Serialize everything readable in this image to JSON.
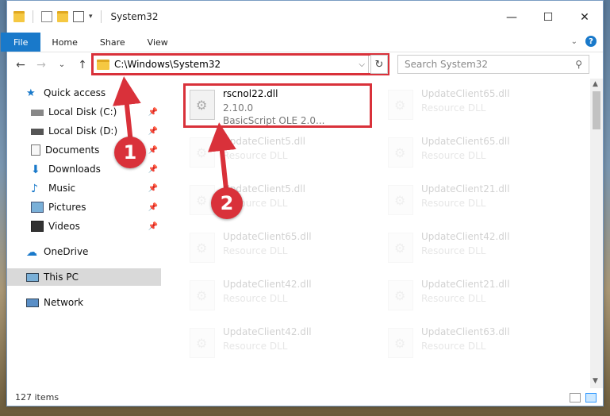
{
  "title": "System32",
  "window_controls": {
    "minimize": "—",
    "maximize": "☐",
    "close": "✕"
  },
  "ribbon": {
    "tabs": [
      "File",
      "Home",
      "Share",
      "View"
    ]
  },
  "nav": {
    "back": "←",
    "forward": "→",
    "recent": "⌄",
    "up": "↑"
  },
  "address": {
    "path": "C:\\Windows\\System32"
  },
  "search": {
    "placeholder": "Search System32"
  },
  "sidebar": {
    "items": [
      {
        "label": "Quick access",
        "icon": "star-icon",
        "pinned": false
      },
      {
        "label": "Local Disk (C:)",
        "icon": "drive-icon",
        "pinned": true
      },
      {
        "label": "Local Disk (D:)",
        "icon": "drive-icon",
        "pinned": true
      },
      {
        "label": "Documents",
        "icon": "documents-icon",
        "pinned": true
      },
      {
        "label": "Downloads",
        "icon": "download-icon",
        "pinned": true
      },
      {
        "label": "Music",
        "icon": "music-icon",
        "pinned": true
      },
      {
        "label": "Pictures",
        "icon": "pictures-icon",
        "pinned": true
      },
      {
        "label": "Videos",
        "icon": "videos-icon",
        "pinned": true
      },
      {
        "label": "OneDrive",
        "icon": "cloud-icon",
        "pinned": false
      },
      {
        "label": "This PC",
        "icon": "computer-icon",
        "pinned": false
      },
      {
        "label": "Network",
        "icon": "network-icon",
        "pinned": false
      }
    ]
  },
  "files": [
    {
      "name": "rscnol22.dll",
      "line2": "2.10.0",
      "line3": "BasicScript OLE 2.0...",
      "highlight": true
    },
    {
      "name": "UpdateClient65.dll",
      "line2": "Resource DLL"
    },
    {
      "name": "UpdateClient5.dll",
      "line2": "Resource DLL"
    },
    {
      "name": "UpdateClient65.dll",
      "line2": "Resource DLL"
    },
    {
      "name": "UpdateClient5.dll",
      "line2": "Resource DLL"
    },
    {
      "name": "UpdateClient21.dll",
      "line2": "Resource DLL"
    },
    {
      "name": "UpdateClient65.dll",
      "line2": "Resource DLL"
    },
    {
      "name": "UpdateClient42.dll",
      "line2": "Resource DLL"
    },
    {
      "name": "UpdateClient42.dll",
      "line2": "Resource DLL"
    },
    {
      "name": "UpdateClient21.dll",
      "line2": "Resource DLL"
    },
    {
      "name": "UpdateClient42.dll",
      "line2": "Resource DLL"
    },
    {
      "name": "UpdateClient63.dll",
      "line2": "Resource DLL"
    }
  ],
  "status": {
    "count": "127 items"
  },
  "markers": [
    "1",
    "2"
  ],
  "colors": {
    "accent": "#1979ca",
    "highlight": "#d9313a"
  }
}
